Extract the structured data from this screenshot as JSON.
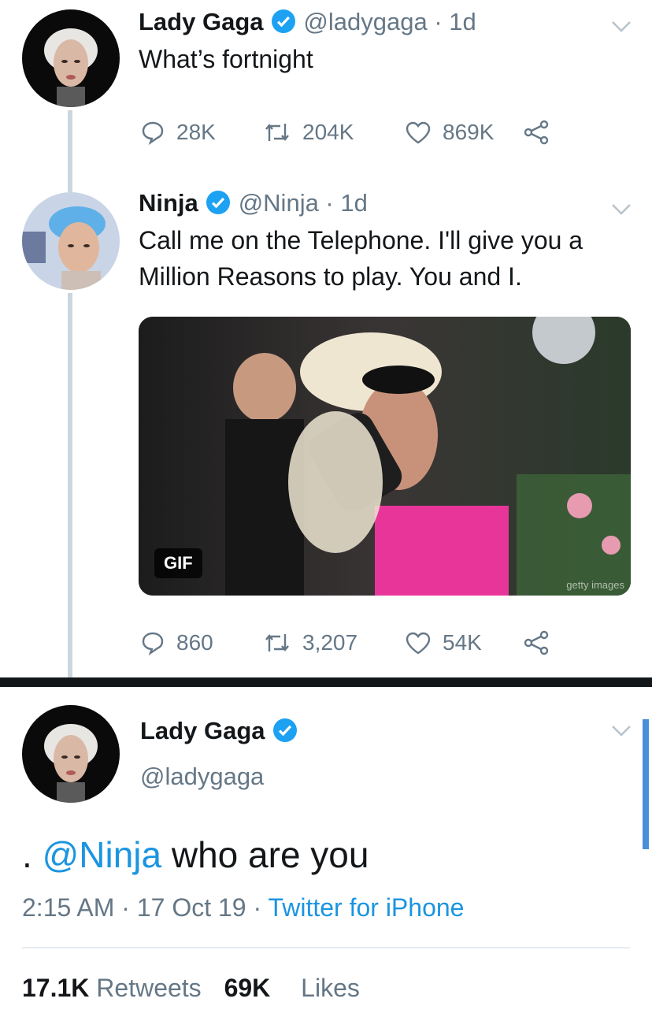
{
  "tweets": [
    {
      "name": "Lady Gaga",
      "handle": "@ladygaga · 1d",
      "text": "What’s fortnight",
      "replies": "28K",
      "retweets": "204K",
      "likes": "869K"
    },
    {
      "name": "Ninja",
      "handle": "@Ninja · 1d",
      "text_line1": "Call me on the Telephone. I'll give you a",
      "text_line2": "Million Reasons to play. You and I.",
      "media_label": "GIF",
      "media_watermark": "getty images",
      "replies": "860",
      "retweets": "3,207",
      "likes": "54K"
    }
  ],
  "main_tweet": {
    "name": "Lady Gaga",
    "handle": "@ladygaga",
    "text_prefix": ". ",
    "mention": "@Ninja",
    "text_suffix": " who are you",
    "time": "2:15 AM",
    "date": "17 Oct 19",
    "separator": "·",
    "source": "Twitter for iPhone",
    "retweets_count": "17.1K",
    "retweets_label": "Retweets",
    "likes_count": "69K",
    "likes_label": "Likes"
  },
  "colors": {
    "verified": "#1da1f2",
    "link": "#1b95e0",
    "muted": "#657786",
    "thread_line": "#ccd6dd"
  }
}
